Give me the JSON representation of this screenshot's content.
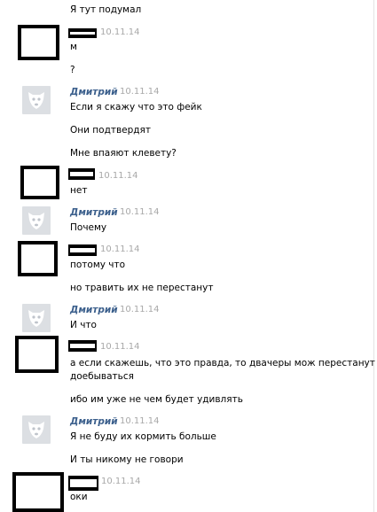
{
  "conversation": {
    "date": "10.11.14",
    "dmitry_name": "Дмитрий",
    "messages": {
      "m0": "Я тут подумал",
      "m1": "м",
      "m2": "?",
      "m3": "Если я скажу что это фейк",
      "m4": "Они подтвердят",
      "m5": "Мне впаяют клевету?",
      "m6": "нет",
      "m7": "Почему",
      "m8": "потому что",
      "m9": "но травить их не перестанут",
      "m10": "И что",
      "m11a": "а если скажешь, что это правда, то двачеры мож перестанут",
      "m11b": "доебываться",
      "m12": "ибо им уже не чем будет удивлять",
      "m13": "Я не буду их кормить больше",
      "m14": "И ты никому не говори",
      "m15": "оки"
    }
  },
  "icons": {
    "default_avatar": "dog-avatar-icon",
    "censor_box": "censored-avatar-box"
  },
  "colors": {
    "name": "#3b5f8c",
    "date": "#a8a8a8",
    "avatar_bg": "#dcdfe3"
  }
}
